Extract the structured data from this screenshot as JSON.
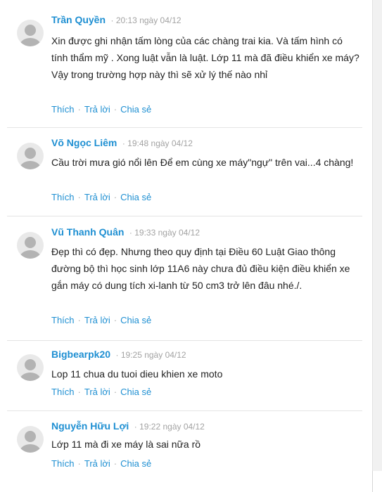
{
  "comments": [
    {
      "author": "Trần Quyền",
      "time": "20:13 ngày 04/12",
      "text": "Xin được ghi nhận tấm lòng của các chàng trai kia. Và tấm hình có tính thẩm mỹ . Xong luật vẫn là luật. Lớp 11 mà đã điều khiển xe máy? Vậy trong trường hợp này thì sẽ xử lý thế nào nhỉ"
    },
    {
      "author": "Võ Ngọc Liêm",
      "time": "19:48 ngày 04/12",
      "text": "Cầu trời mưa gió nổi lên Để em cùng xe máy\"ngự\" trên vai...4 chàng!"
    },
    {
      "author": "Vũ Thanh Quân",
      "time": "19:33 ngày 04/12",
      "text": "Đẹp thì có đẹp. Nhưng theo quy định tại Điều 60 Luật Giao thông đường bộ thì học sinh lớp 11A6 này chưa đủ điều kiện điều khiển xe gắn máy có dung tích xi-lanh từ 50 cm3 trở lên đâu nhé./."
    },
    {
      "author": "Bigbearpk20",
      "time": "19:25 ngày 04/12",
      "text": "Lop 11 chua du tuoi dieu khien xe moto"
    },
    {
      "author": "Nguyễn Hữu Lợi",
      "time": "19:22 ngày 04/12",
      "text": "Lớp 11 mà đi xe máy là sai nữa rồ"
    }
  ],
  "actions": {
    "like": "Thích",
    "reply": "Trả lời",
    "share": "Chia sẻ",
    "separator": "·"
  },
  "colors": {
    "accent": "#1e8fd2",
    "meta": "#a3a3a3",
    "text": "#222222"
  }
}
